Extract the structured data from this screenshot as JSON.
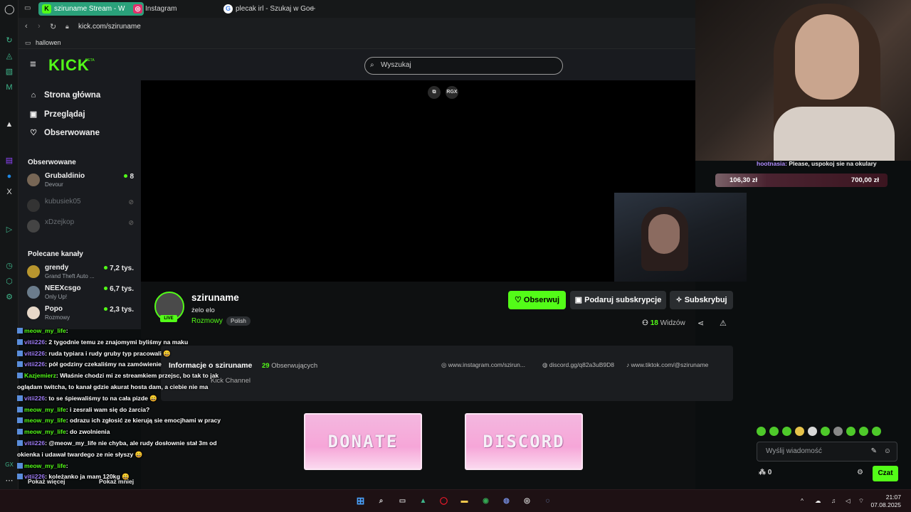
{
  "browser": {
    "tabs": [
      {
        "label": "sziruname Stream - W",
        "icon": "K"
      },
      {
        "label": "Instagram",
        "icon": "◎"
      },
      {
        "label": "plecak irl - Szukaj w Goog",
        "icon": "G"
      }
    ],
    "new_tab": "+",
    "url": "kick.com/sziruname",
    "bookmark": "hallowen"
  },
  "kick": {
    "logo": "KICK",
    "logo_beta": "BETA",
    "search_placeholder": "Wyszukaj",
    "nav": [
      {
        "label": "Strona główna",
        "icon": "⌂"
      },
      {
        "label": "Przeglądaj",
        "icon": "▣"
      },
      {
        "label": "Obserwowane",
        "icon": "♡"
      }
    ],
    "followed_heading": "Obserwowane",
    "followed": [
      {
        "name": "Grubaldinio",
        "game": "Devour",
        "count": "8",
        "live": true
      },
      {
        "name": "kubusiek05",
        "game": "",
        "count": "",
        "live": false
      },
      {
        "name": "xDzejkop",
        "game": "",
        "count": "",
        "live": false
      }
    ],
    "recommended_heading": "Polecane kanały",
    "recommended": [
      {
        "name": "grendy",
        "game": "Grand Theft Auto ...",
        "count": "7,2 tys."
      },
      {
        "name": "NEEXcsgo",
        "game": "Only Up!",
        "count": "6,7 tys."
      },
      {
        "name": "Popo",
        "game": "Rozmowy",
        "count": "2,3 tys."
      }
    ],
    "show_more": "Pokaż więcej",
    "show_less": "Pokaż mniej",
    "player_buttons": [
      "⧉",
      "RGX"
    ]
  },
  "channel": {
    "name": "sziruname",
    "title": "żelo elo",
    "category": "Rozmowy",
    "language": "Polish",
    "live_label": "LIVE",
    "follow_button": "Obserwuj",
    "gift_button": "Podaruj subskrypcje",
    "subscribe_button": "Subskrybuj",
    "viewers_count": "18",
    "viewers_label": "Widzów",
    "about_title": "Informacje o sziruname",
    "followers_count": "29",
    "followers_label": "Obserwujących",
    "about_sub": "Kick Channel",
    "links": [
      {
        "icon": "◎",
        "text": "www.instagram.com/szirun..."
      },
      {
        "icon": "◍",
        "text": "discord.gg/q82a3uB9D8"
      },
      {
        "icon": "♪",
        "text": "www.tiktok.com/@sziruname"
      }
    ],
    "banners": [
      "DONATE",
      "DISCORD"
    ]
  },
  "overlay": {
    "goal_username": "hootnasia:",
    "goal_text": "Please, uspokoj sie na okulary",
    "goal_current": "106,30 zł",
    "goal_target": "700,00 zł",
    "goal_progress": 0.15
  },
  "chat_log": [
    {
      "user": "meow_my_life",
      "text": ":",
      "color": "green"
    },
    {
      "user": "vitii226",
      "text": ": 2 tygodnie temu ze znajomymi byliśmy na maku",
      "color": "purple"
    },
    {
      "user": "vitii226",
      "text": ": ruda typiara i rudy gruby typ pracowali 😄",
      "color": "purple"
    },
    {
      "user": "vitii226",
      "text": ": pół godziny czekaliśmy na zamówienie",
      "color": "purple"
    },
    {
      "user": "Kazjemierz",
      "text": ": Właśnie chodzi mi ze streamkiem przejsc, bo tak to jak",
      "color": "green"
    },
    {
      "user": "",
      "text": "oglądam twitcha, to kanał gdzie akurat hosta dam, a ciebie nie ma",
      "color": ""
    },
    {
      "user": "",
      "text": "",
      "color": ""
    },
    {
      "user": "vitii226",
      "text": ": to se śpiewaliśmy to na cała pizde 😄",
      "color": "purple"
    },
    {
      "user": "meow_my_life",
      "text": ": i zesrali wam się do żarcia?",
      "color": "green"
    },
    {
      "user": "meow_my_life",
      "text": ": odrazu ich zgłosić ze kierują sie emocjhami w pracy",
      "color": "green"
    },
    {
      "user": "meow_my_life",
      "text": ": do zwolnienia",
      "color": "green"
    },
    {
      "user": "vitii226",
      "text": ": @meow_my_life nie chyba, ale rudy dosłownie stał 3m od",
      "color": "purple"
    },
    {
      "user": "",
      "text": "okienka i udawał twardego ze nie słyszy 😄",
      "color": ""
    },
    {
      "user": "meow_my_life",
      "text": ":",
      "color": "green"
    },
    {
      "user": "vitii226",
      "text": ": koleżanko ja mam 120kg 😄",
      "color": "purple"
    }
  ],
  "chat": {
    "input_placeholder": "Wyślij wiadomość",
    "points": "0",
    "send_button": "Czat"
  },
  "taskbar": {
    "tray_lang": "^",
    "time": "21:07",
    "date": "07.08.2025"
  },
  "colors": {
    "kick_green": "#53fc18",
    "browser_accent": "#2aa17a",
    "banner_pink": "#f6a6d8"
  }
}
